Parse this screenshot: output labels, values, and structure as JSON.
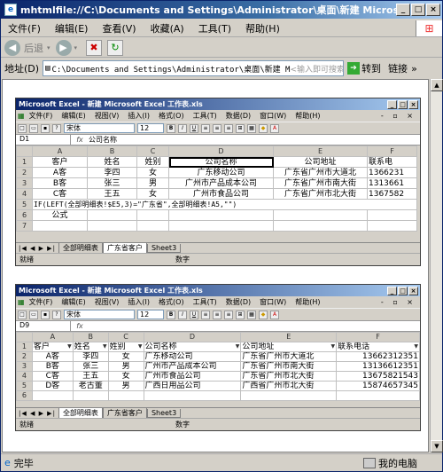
{
  "window": {
    "title": "mhtmlfile://C:\\Documents and Settings\\Administrator\\桌面\\新建 Microsoft Word 文档.mht",
    "menu": [
      "文件(F)",
      "编辑(E)",
      "查看(V)",
      "收藏(A)",
      "工具(T)",
      "帮助(H)"
    ],
    "toolbar": {
      "back": "后退"
    },
    "address": {
      "label": "地址(D)",
      "value": "C:\\Documents and Settings\\Administrator\\桌面\\新建 M",
      "placeholder": "<输入即可搜索>",
      "go": "转到",
      "links": "链接"
    },
    "status": {
      "left": "完毕",
      "right": "我的电脑"
    }
  },
  "excel1": {
    "title": "Microsoft Excel - 新建 Microsoft Excel 工作表.xls",
    "menu": [
      "文件(F)",
      "编辑(E)",
      "视图(V)",
      "插入(I)",
      "格式(O)",
      "工具(T)",
      "数据(D)",
      "窗口(W)",
      "帮助(H)"
    ],
    "font": "宋体",
    "size": "12",
    "namebox": "D1",
    "fx": "fx",
    "formula": "公司名称",
    "columns": [
      "A",
      "B",
      "C",
      "D",
      "E",
      "F"
    ],
    "rows": [
      {
        "n": "1",
        "cells": [
          "客户",
          "姓名",
          "姓别",
          "公司名称",
          "公司地址",
          "联系电"
        ]
      },
      {
        "n": "2",
        "cells": [
          "A客",
          "李四",
          "女",
          "广东移动公司",
          "广东省广州市大道北",
          "1366231"
        ]
      },
      {
        "n": "3",
        "cells": [
          "B客",
          "张三",
          "男",
          "广州市产品成本公司",
          "广东省广州市南大街",
          "1313661"
        ]
      },
      {
        "n": "4",
        "cells": [
          "C客",
          "王五",
          "女",
          "广州市食品公司",
          "广东省广州市北大街",
          "1367582"
        ]
      },
      {
        "n": "5",
        "formula": "IF(LEFT(全部明细表!$E5,3)=\"广东省\",全部明细表!A5,\"\")"
      },
      {
        "n": "6",
        "cells": [
          "公式",
          "",
          "",
          "",
          "",
          ""
        ]
      },
      {
        "n": "7",
        "cells": [
          "",
          "",
          "",
          "",
          "",
          ""
        ]
      }
    ],
    "tabs": [
      "全部明细表",
      "广东省客户",
      "Sheet3"
    ],
    "status": "就绪",
    "status_right": "数字"
  },
  "excel2": {
    "title": "Microsoft Excel - 新建 Microsoft Excel 工作表.xls",
    "menu": [
      "文件(F)",
      "编辑(E)",
      "视图(V)",
      "插入(I)",
      "格式(O)",
      "工具(T)",
      "数据(D)",
      "窗口(W)",
      "帮助(H)"
    ],
    "font": "宋体",
    "size": "12",
    "namebox": "D9",
    "fx": "fx",
    "formula": "",
    "columns": [
      "A",
      "B",
      "C",
      "D",
      "E",
      "F"
    ],
    "rows": [
      {
        "n": "1",
        "cells": [
          "客户",
          "姓名",
          "姓别",
          "公司名称",
          "公司地址",
          "联系电话"
        ]
      },
      {
        "n": "2",
        "cells": [
          "A客",
          "李四",
          "女",
          "广东移动公司",
          "广东省广州市大道北",
          "13662312351"
        ]
      },
      {
        "n": "3",
        "cells": [
          "B客",
          "张三",
          "男",
          "广州市产品成本公司",
          "广东省广州市南大街",
          "13136612351"
        ]
      },
      {
        "n": "4",
        "cells": [
          "C客",
          "王五",
          "女",
          "广州市食品公司",
          "广东省广州市北大街",
          "13675821543"
        ]
      },
      {
        "n": "5",
        "cells": [
          "D客",
          "老古董",
          "男",
          "广西日用品公司",
          "广西省广州市北大街",
          "15874657345"
        ]
      },
      {
        "n": "6",
        "cells": [
          "",
          "",
          "",
          "",
          "",
          ""
        ]
      }
    ],
    "tabs": [
      "全部明细表",
      "广东省客户",
      "Sheet3"
    ],
    "status": "就绪",
    "status_right": "数字"
  }
}
